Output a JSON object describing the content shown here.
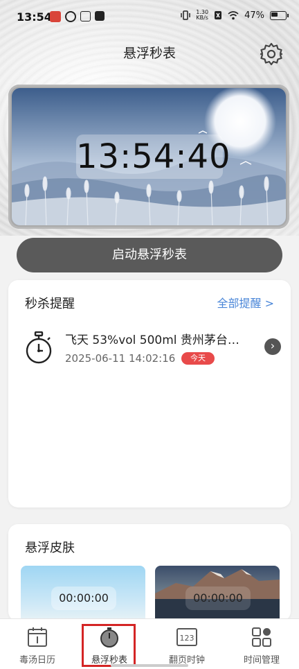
{
  "status_bar": {
    "time": "13:54",
    "net_speed_value": "1.30",
    "net_speed_unit": "KB/s",
    "battery_percent": "47%"
  },
  "header": {
    "title": "悬浮秒表"
  },
  "hero": {
    "clock": "13:54:40"
  },
  "actions": {
    "start_label": "启动悬浮秒表"
  },
  "reminder": {
    "title": "秒杀提醒",
    "all_link": "全部提醒 >",
    "items": [
      {
        "name": "飞天 53%vol 500ml 贵州茅台…",
        "time": "2025-06-11 14:02:16",
        "badge": "今天"
      }
    ]
  },
  "skins": {
    "title": "悬浮皮肤",
    "items": [
      {
        "clock": "00:00:00"
      },
      {
        "clock": "00:00:00"
      }
    ]
  },
  "tabs": [
    {
      "label": "毒汤日历",
      "icon": "calendar-icon",
      "active": false
    },
    {
      "label": "悬浮秒表",
      "icon": "stopwatch-icon",
      "active": true
    },
    {
      "label": "翻页时钟",
      "icon": "flip-clock-icon",
      "active": false
    },
    {
      "label": "时间管理",
      "icon": "grid-icon",
      "active": false
    }
  ],
  "colors": {
    "accent_link": "#4a86d8",
    "badge_red": "#e84a4a",
    "button_dark": "#5a5a5a",
    "highlight_red": "#d42525"
  }
}
